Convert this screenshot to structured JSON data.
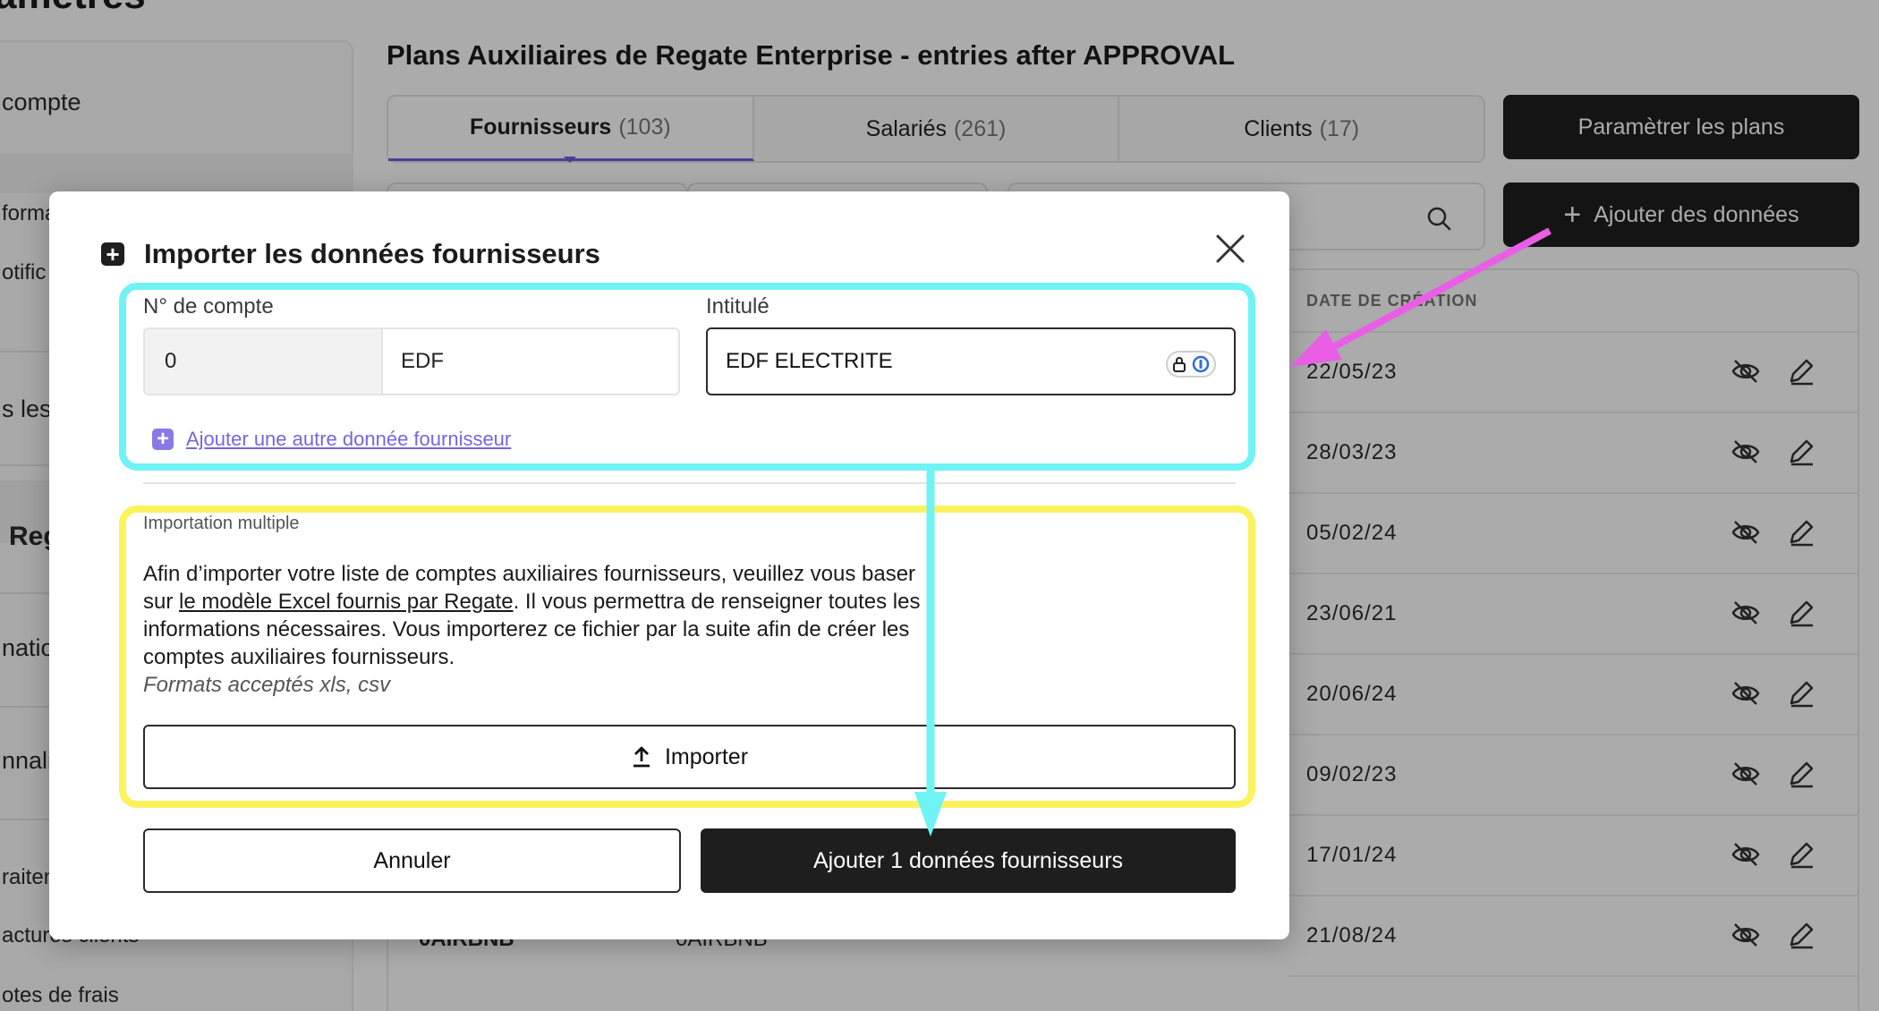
{
  "background": {
    "page_heading": "amètres",
    "sidebar": {
      "items": [
        "compte",
        "forma",
        "otific",
        "s les",
        "Reg",
        "natio",
        "nnali",
        "raiten",
        "actures clients",
        "otes de frais"
      ]
    },
    "plans_title": "Plans Auxiliaires de Regate Enterprise - entries after APPROVAL",
    "tabs": [
      {
        "label": "Fournisseurs",
        "count": "(103)"
      },
      {
        "label": "Salariés",
        "count": "(261)"
      },
      {
        "label": "Clients",
        "count": "(17)"
      }
    ],
    "configure_plans_label": "Paramètrer les plans",
    "add_data_label": "Ajouter des données",
    "table": {
      "date_header": "DATE DE CRÉATION",
      "dates": [
        "22/05/23",
        "28/03/23",
        "05/02/24",
        "23/06/21",
        "20/06/24",
        "09/02/23",
        "17/01/24",
        "21/08/24"
      ],
      "last_row_code": "0AIRBNB",
      "last_row_name": "0AIRBNB"
    }
  },
  "modal": {
    "title": "Importer les données fournisseurs",
    "account": {
      "label": "N° de compte",
      "prefix": "0",
      "value": "EDF"
    },
    "intitule": {
      "label": "Intitulé",
      "value": "EDF ELECTRITE"
    },
    "add_another_label": "Ajouter une autre donnée fournisseur",
    "import_section": {
      "label": "Importation multiple",
      "text_before": "Afin d’importer votre liste de comptes auxiliaires fournisseurs, veuillez vous baser sur ",
      "link": "le modèle Excel fournis par Regate",
      "text_after": ". Il vous permettra de renseigner toutes les informations nécessaires. Vous importerez ce fichier par la suite afin de créer les comptes auxiliaires fournisseurs.",
      "formats": "Formats acceptés xls, csv",
      "import_button": "Importer"
    },
    "cancel_button": "Annuler",
    "submit_button": "Ajouter 1 données fournisseurs"
  },
  "annotation_colors": {
    "cyan": "#6ff3f5",
    "yellow": "#fbf35e",
    "magenta": "#ea5ee6"
  }
}
